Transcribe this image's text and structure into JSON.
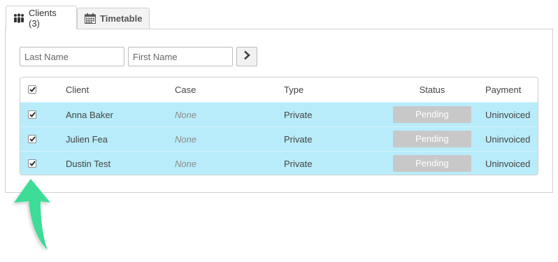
{
  "tabs": [
    {
      "label": "Clients (3)",
      "icon": "people-icon",
      "active": true
    },
    {
      "label": "Timetable",
      "icon": "calendar-icon",
      "active": false
    }
  ],
  "filters": {
    "last_name_placeholder": "Last Name",
    "first_name_placeholder": "First Name",
    "go_icon": "chevron-right-icon"
  },
  "table": {
    "header_checked": true,
    "columns": [
      "Client",
      "Case",
      "Type",
      "Status",
      "Payment"
    ],
    "rows": [
      {
        "checked": true,
        "client": "Anna Baker",
        "case": "None",
        "type": "Private",
        "status": "Pending",
        "payment": "Uninvoiced"
      },
      {
        "checked": true,
        "client": "Julien Fea",
        "case": "None",
        "type": "Private",
        "status": "Pending",
        "payment": "Uninvoiced"
      },
      {
        "checked": true,
        "client": "Dustin Test",
        "case": "None",
        "type": "Private",
        "status": "Pending",
        "payment": "Uninvoiced"
      }
    ]
  },
  "colors": {
    "row_highlight": "#b8ecfa",
    "pending_badge": "#c8c8c8",
    "arrow": "#3ddc97"
  }
}
